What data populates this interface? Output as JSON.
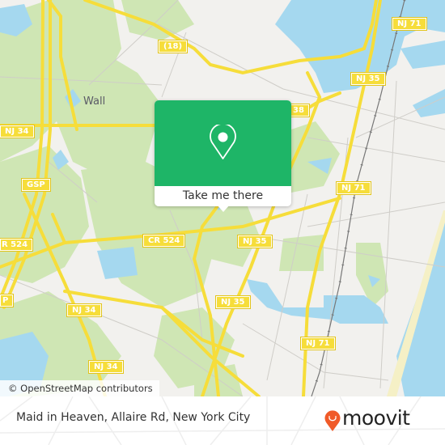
{
  "map": {
    "place_labels": [
      {
        "id": "wall",
        "text": "Wall"
      }
    ],
    "road_shields": [
      {
        "id": "nj34-west",
        "text": "NJ 34"
      },
      {
        "id": "gsp",
        "text": "GSP"
      },
      {
        "id": "cr524-west",
        "text": "R 524"
      },
      {
        "id": "cr524",
        "text": "CR 524"
      },
      {
        "id": "p-edge",
        "text": "P"
      },
      {
        "id": "nj34-mid",
        "text": "NJ 34"
      },
      {
        "id": "nj34-south",
        "text": "NJ 34"
      },
      {
        "id": "route18",
        "text": "(18)"
      },
      {
        "id": "nj38",
        "text": "38"
      },
      {
        "id": "nj35-north",
        "text": "NJ 35"
      },
      {
        "id": "nj71-north",
        "text": "NJ 71"
      },
      {
        "id": "nj71-mid",
        "text": "NJ 71"
      },
      {
        "id": "nj35-mid",
        "text": "NJ 35"
      },
      {
        "id": "nj35-south",
        "text": "NJ 35"
      },
      {
        "id": "nj71-south",
        "text": "NJ 71"
      }
    ],
    "attribution": "© OpenStreetMap contributors",
    "colors": {
      "land": "#f2f1ee",
      "park": "#cfe6b4",
      "water": "#a5d8ef",
      "road": "#f6dd3a",
      "minor_road": "#cfcdc8",
      "beach": "#f5f0c6",
      "railway": "#777777"
    }
  },
  "popup": {
    "icon": "location-pin-icon",
    "cta_label": "Take me there",
    "accent_color": "#1eb567"
  },
  "footer": {
    "location_title": "Maid in Heaven, Allaire Rd, New York City",
    "brand": "moovit",
    "brand_color": "#f05a28"
  }
}
